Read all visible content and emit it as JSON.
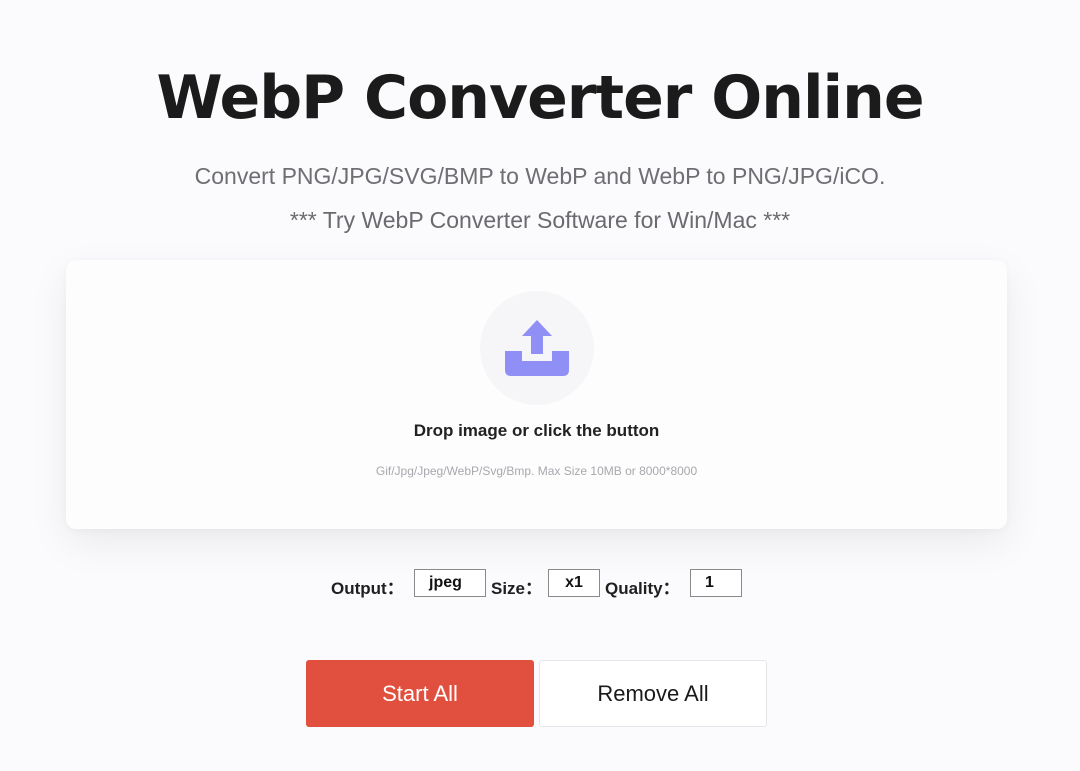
{
  "header": {
    "title": "WebP Converter Online",
    "subtitle": "Convert PNG/JPG/SVG/BMP to WebP and WebP to PNG/JPG/iCO.",
    "software_link": "*** Try WebP Converter Software for Win/Mac ***"
  },
  "upload": {
    "icon": "upload-tray-icon",
    "icon_color": "#8f8ff5",
    "title": "Drop image or click the button",
    "hint": "Gif/Jpg/Jpeg/WebP/Svg/Bmp. Max Size 10MB or 8000*8000"
  },
  "options": {
    "output_label": "Output：",
    "output_value": "jpeg",
    "size_label": "Size：",
    "size_value": "x1",
    "quality_label": "Quality：",
    "quality_value": "1"
  },
  "actions": {
    "start_label": "Start All",
    "remove_label": "Remove All",
    "start_color": "#e1503f"
  }
}
